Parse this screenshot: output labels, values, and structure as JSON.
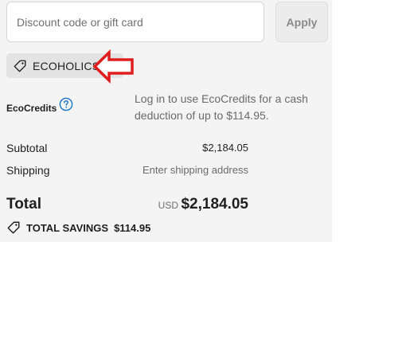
{
  "discount": {
    "input_value": "",
    "placeholder": "Discount code or gift card",
    "apply_label": "Apply",
    "applied_code": "ECOHOLICS"
  },
  "ecocredits": {
    "label": "EcoCredits",
    "message": "Log in to use EcoCredits for a cash deduction of up to $114.95."
  },
  "summary": {
    "subtotal_label": "Subtotal",
    "subtotal_value": "$2,184.05",
    "shipping_label": "Shipping",
    "shipping_value": "Enter shipping address",
    "total_label": "Total",
    "currency": "USD",
    "total_value": "$2,184.05",
    "savings_label": "TOTAL SAVINGS",
    "savings_value": "$114.95"
  },
  "colors": {
    "panel_bg": "#f4f4f4",
    "annotation_arrow": "#e01e1e",
    "help_icon": "#1773c9"
  },
  "icons": {
    "code_tag": "tag-icon",
    "remove_code": "close-icon",
    "help": "help-circle-icon",
    "savings": "tag-icon",
    "annotation": "left-arrow-icon"
  }
}
